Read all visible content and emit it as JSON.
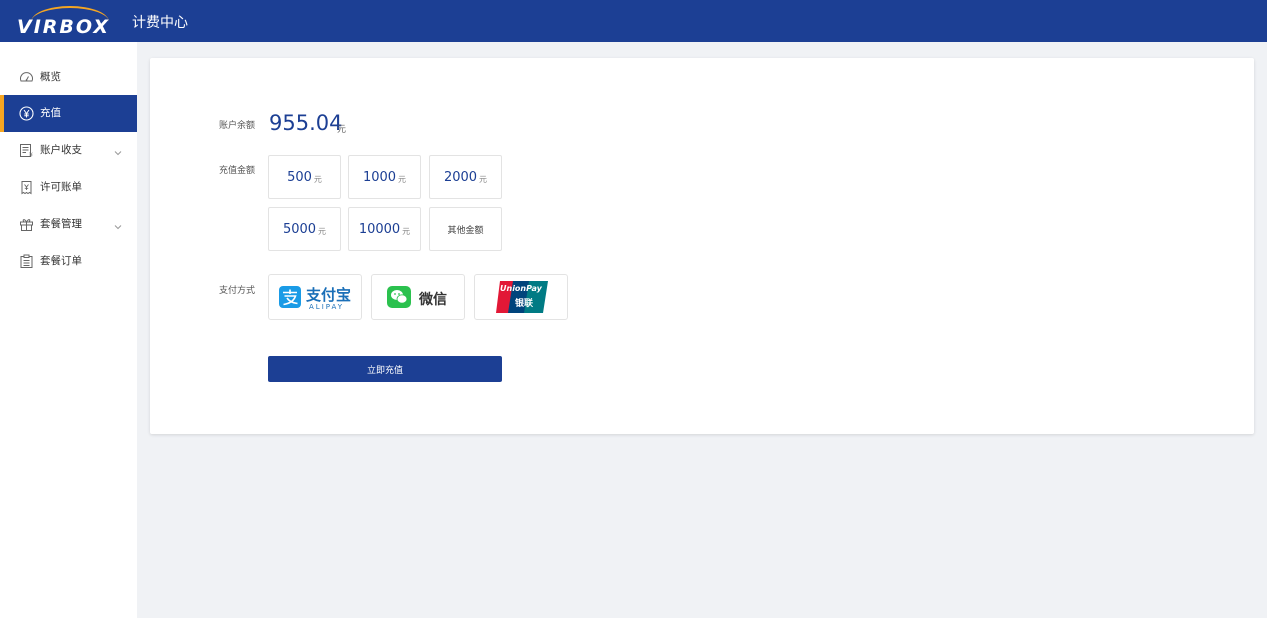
{
  "header": {
    "logo_text": "VIRBOX",
    "app_title": "计费中心"
  },
  "sidebar": {
    "items": [
      {
        "label": "概览",
        "icon": "dashboard-icon",
        "active": false
      },
      {
        "label": "充值",
        "icon": "yen-coin-icon",
        "active": true
      },
      {
        "label": "账户收支",
        "icon": "ledger-icon",
        "active": false,
        "expandable": true
      },
      {
        "label": "许可账单",
        "icon": "receipt-icon",
        "active": false
      },
      {
        "label": "套餐管理",
        "icon": "gift-icon",
        "active": false,
        "expandable": true
      },
      {
        "label": "套餐订单",
        "icon": "clipboard-icon",
        "active": false
      }
    ]
  },
  "recharge": {
    "balance_label": "账户余额",
    "balance_value": "955.04",
    "balance_unit": "元",
    "amount_label": "充值金额",
    "amounts": [
      {
        "value": "500",
        "unit": "元"
      },
      {
        "value": "1000",
        "unit": "元"
      },
      {
        "value": "2000",
        "unit": "元"
      },
      {
        "value": "5000",
        "unit": "元"
      },
      {
        "value": "10000",
        "unit": "元"
      }
    ],
    "other_amount": "其他金额",
    "payment_label": "支付方式",
    "payment_methods": {
      "alipay": {
        "name": "支付宝",
        "sub": "ALIPAY"
      },
      "wechat": {
        "name": "微信"
      },
      "unionpay": {
        "name": "UnionPay",
        "sub": "银联"
      }
    },
    "submit_label": "立即充值"
  },
  "colors": {
    "brand": "#1c3f94",
    "accent": "#f5a623",
    "alipay": "#1a9be6",
    "wechat": "#2bc14e",
    "background": "#f0f2f5"
  }
}
